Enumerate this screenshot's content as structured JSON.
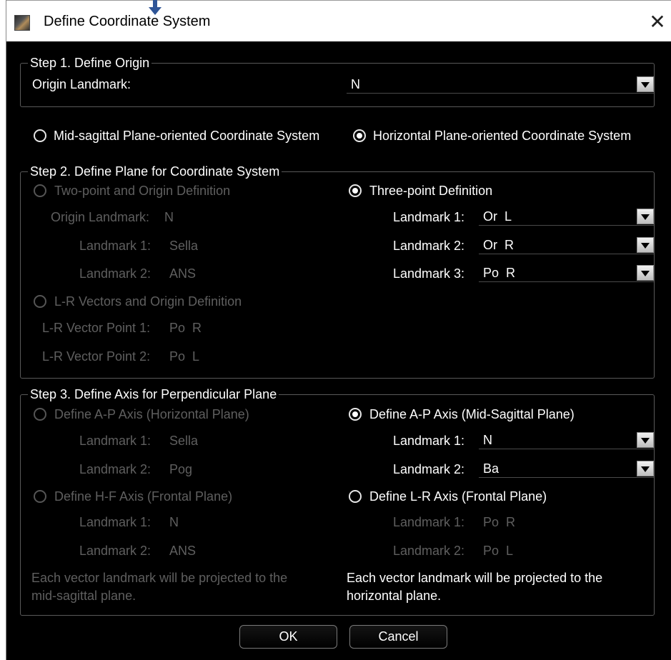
{
  "window": {
    "title": "Define Coordinate System",
    "close_glyph": "✕",
    "icon": "app-logo-icon"
  },
  "step1": {
    "legend": "Step 1. Define Origin",
    "origin_label": "Origin Landmark:",
    "origin_value": "N"
  },
  "system": {
    "midsagittal_label": "Mid-sagittal Plane-oriented Coordinate System",
    "horizontal_label": "Horizontal Plane-oriented Coordinate System",
    "selected": "horizontal"
  },
  "step2": {
    "legend": "Step 2. Define Plane for Coordinate System",
    "two_point": {
      "label": "Two-point and Origin Definition",
      "origin_label": "Origin Landmark:",
      "origin_value": "N",
      "lm1_label": "Landmark 1:",
      "lm1_value": "Sella",
      "lm2_label": "Landmark 2:",
      "lm2_value": "ANS"
    },
    "lr_vectors": {
      "label": "L-R Vectors and Origin Definition",
      "p1_label": "L-R Vector Point 1:",
      "p1_value": "Po  R",
      "p2_label": "L-R Vector Point 2:",
      "p2_value": "Po  L"
    },
    "three_point": {
      "label": "Three-point Definition",
      "lm1_label": "Landmark 1:",
      "lm1_value": "Or  L",
      "lm2_label": "Landmark 2:",
      "lm2_value": "Or  R",
      "lm3_label": "Landmark 3:",
      "lm3_value": "Po  R"
    }
  },
  "step3": {
    "legend": "Step 3. Define Axis for Perpendicular Plane",
    "ap_horizontal": {
      "label": "Define A-P Axis (Horizontal Plane)",
      "lm1_label": "Landmark 1:",
      "lm1_value": "Sella",
      "lm2_label": "Landmark 2:",
      "lm2_value": "Pog"
    },
    "hf_frontal": {
      "label": "Define H-F Axis (Frontal Plane)",
      "lm1_label": "Landmark 1:",
      "lm1_value": "N",
      "lm2_label": "Landmark 2:",
      "lm2_value": "ANS"
    },
    "ap_midsagittal": {
      "label": "Define A-P Axis (Mid-Sagittal Plane)",
      "lm1_label": "Landmark 1:",
      "lm1_value": "N",
      "lm2_label": "Landmark 2:",
      "lm2_value": "Ba"
    },
    "lr_frontal": {
      "label": "Define L-R Axis (Frontal Plane)",
      "lm1_label": "Landmark 1:",
      "lm1_value": "Po  R",
      "lm2_label": "Landmark 2:",
      "lm2_value": "Po  L"
    },
    "note_left_1": "Each vector landmark will be projected to the",
    "note_left_2": "mid-sagittal plane.",
    "note_right_1": "Each vector landmark will be projected to the",
    "note_right_2": "horizontal plane."
  },
  "buttons": {
    "ok": "OK",
    "cancel": "Cancel"
  },
  "colors": {
    "background": "#000000",
    "text": "#ffffff",
    "disabled_text": "#5f5f5f",
    "marker_arrow": "#2f5597"
  }
}
